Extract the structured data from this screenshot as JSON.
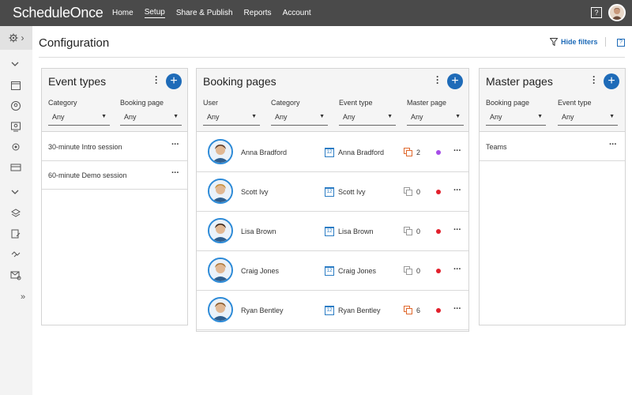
{
  "app": {
    "logo": "ScheduleOnce",
    "nav": [
      "Home",
      "Setup",
      "Share & Publish",
      "Reports",
      "Account"
    ],
    "help_label": "?"
  },
  "header": {
    "title": "Configuration",
    "hide_filters": "Hide filters",
    "help_label": "?"
  },
  "event_types": {
    "title": "Event types",
    "add_label": "+",
    "filters": [
      {
        "label": "Category",
        "value": "Any"
      },
      {
        "label": "Booking page",
        "value": "Any"
      }
    ],
    "items": [
      "30-minute Intro session",
      "60-minute Demo session"
    ]
  },
  "booking_pages": {
    "title": "Booking pages",
    "add_label": "+",
    "filters": [
      {
        "label": "User",
        "value": "Any"
      },
      {
        "label": "Category",
        "value": "Any"
      },
      {
        "label": "Event type",
        "value": "Any"
      },
      {
        "label": "Master page",
        "value": "Any"
      }
    ],
    "rows": [
      {
        "user": "Anna Bradford",
        "page": "Anna Bradford",
        "master_count": "2",
        "icon_color": "#e06a2f",
        "status_color": "#a64de8"
      },
      {
        "user": "Scott Ivy",
        "page": "Scott Ivy",
        "master_count": "0",
        "icon_color": "#9a9a9a",
        "status_color": "#e2202c"
      },
      {
        "user": "Lisa Brown",
        "page": "Lisa Brown",
        "master_count": "0",
        "icon_color": "#9a9a9a",
        "status_color": "#e2202c"
      },
      {
        "user": "Craig Jones",
        "page": "Craig Jones",
        "master_count": "0",
        "icon_color": "#9a9a9a",
        "status_color": "#e2202c"
      },
      {
        "user": "Ryan Bentley",
        "page": "Ryan Bentley",
        "master_count": "6",
        "icon_color": "#e06a2f",
        "status_color": "#e2202c"
      }
    ],
    "calendar_glyph": "12"
  },
  "master_pages": {
    "title": "Master pages",
    "add_label": "+",
    "filters": [
      {
        "label": "Booking page",
        "value": "Any"
      },
      {
        "label": "Event type",
        "value": "Any"
      }
    ],
    "items": [
      "Teams"
    ]
  },
  "colors": {
    "topbar": "#4a4a4a",
    "accent": "#1e6bb8"
  }
}
